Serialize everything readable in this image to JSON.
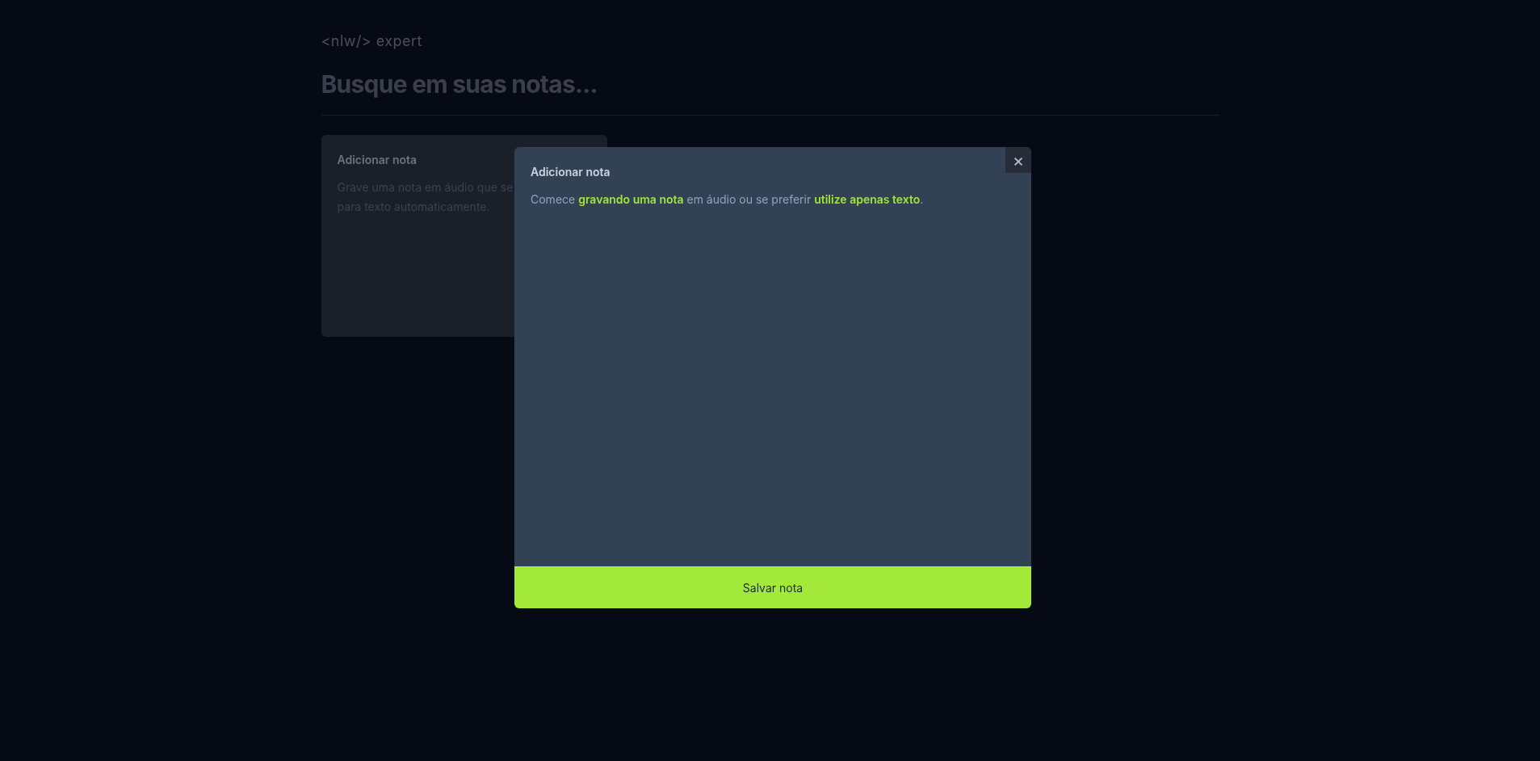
{
  "logo": {
    "text": "<nlw/> expert"
  },
  "search": {
    "placeholder": "Busque em suas notas..."
  },
  "add_card": {
    "title": "Adicionar nota",
    "description_lines": [
      "Grave uma nota em áudio que se",
      "para texto automaticamente."
    ]
  },
  "dialog": {
    "title": "Adicionar nota",
    "close": "×",
    "intro": [
      {
        "kind": "text",
        "text": "Comece "
      },
      {
        "kind": "link",
        "text": "gravando uma nota"
      },
      {
        "kind": "text",
        "text": " em áudio ou se preferir "
      },
      {
        "kind": "link",
        "text": "utilize apenas texto"
      },
      {
        "kind": "text",
        "text": "."
      }
    ],
    "save_button": "Salvar nota"
  }
}
